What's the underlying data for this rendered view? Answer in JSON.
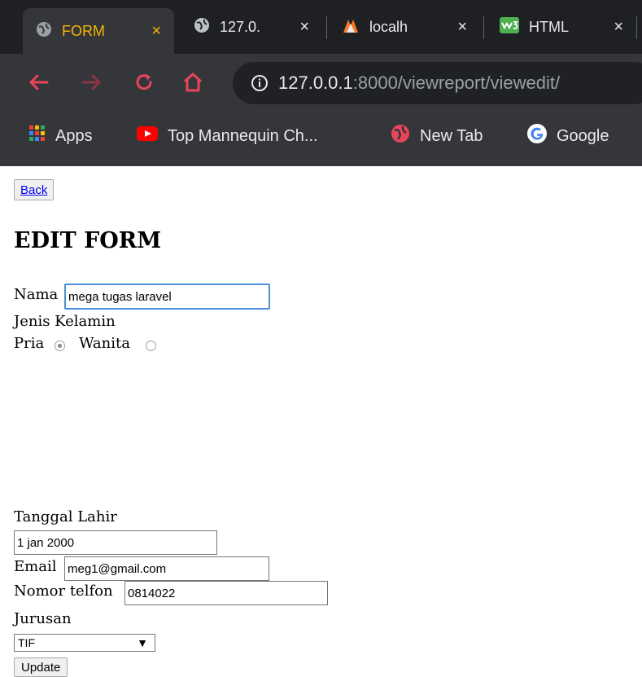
{
  "browser": {
    "tabs": [
      {
        "title": "FORM",
        "close": "×",
        "active": true
      },
      {
        "title": "127.0.",
        "close": "×"
      },
      {
        "title": "localh",
        "close": "×"
      },
      {
        "title": "HTML",
        "close": "×"
      }
    ],
    "address": {
      "host": "127.0.0.1",
      "path": ":8000/viewreport/viewedit/"
    },
    "bookmarks": [
      {
        "label": "Apps",
        "icon": "apps-grid-icon"
      },
      {
        "label": "Top Mannequin Ch...",
        "icon": "youtube-icon"
      },
      {
        "label": "New Tab",
        "icon": "globe-icon"
      },
      {
        "label": "Google",
        "icon": "google-icon"
      }
    ]
  },
  "page": {
    "back_label": "Back",
    "title": "EDIT FORM",
    "nama_label": "Nama",
    "nama_value": "mega tugas laravel",
    "gender_label": "Jenis Kelamin",
    "gender_options": [
      "Pria",
      "Wanita"
    ],
    "gender_selected": "Pria",
    "tanggal_label": "Tanggal Lahir",
    "tanggal_value": "1 jan 2000",
    "email_label": "Email",
    "email_value": "meg1@gmail.com",
    "telfon_label": "Nomor telfon",
    "telfon_value": "0814022",
    "jurusan_label": "Jurusan",
    "jurusan_value": "TIF",
    "update_label": "Update"
  },
  "colors": {
    "active_tab_text": "#f5b500",
    "focus_border": "#4a90d9",
    "link": "#0000ee",
    "nav_icons": "#e8455a"
  }
}
